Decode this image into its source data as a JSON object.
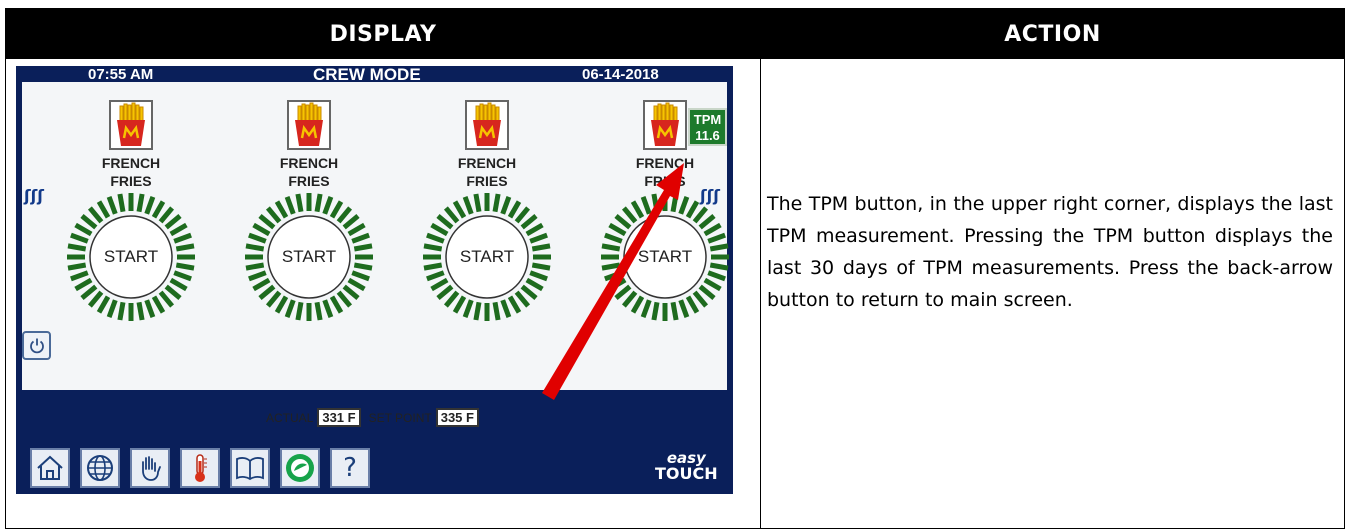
{
  "table": {
    "display_header": "DISPLAY",
    "action_header": "ACTION"
  },
  "screen": {
    "time": "07:55 AM",
    "mode": "CREW MODE",
    "date": "06-14-2018",
    "tpm_label": "TPM",
    "tpm_value": "11.6",
    "vats": [
      {
        "line1": "FRENCH",
        "line2": "FRIES",
        "button": "START"
      },
      {
        "line1": "FRENCH",
        "line2": "FRIES",
        "button": "START"
      },
      {
        "line1": "FRENCH",
        "line2": "FRIES",
        "button": "START"
      },
      {
        "line1": "FRENCH",
        "line2": "FRIES",
        "button": "START"
      }
    ],
    "actual_label": "ACTUAL",
    "actual_value": "331 F",
    "setpoint_label": "SET POINT",
    "setpoint_value": "335 F",
    "bottom_icons": [
      "home-icon",
      "globe-icon",
      "hand-icon",
      "thermometer-icon",
      "book-icon",
      "filter-icon",
      "help-icon"
    ],
    "help_glyph": "?",
    "logo_top": "easy",
    "logo_bottom": "TOUCH",
    "colors": {
      "frame": "#0a1f5a",
      "dial_tick": "#1e6b1e",
      "tpm_bg": "#1d7a2c",
      "arrow": "#e00000"
    }
  },
  "action_text": "The TPM button, in the upper right corner, displays the last TPM measurement.  Pressing the TPM button displays the last 30 days of TPM measurements.  Press the back-arrow button to return to main screen."
}
